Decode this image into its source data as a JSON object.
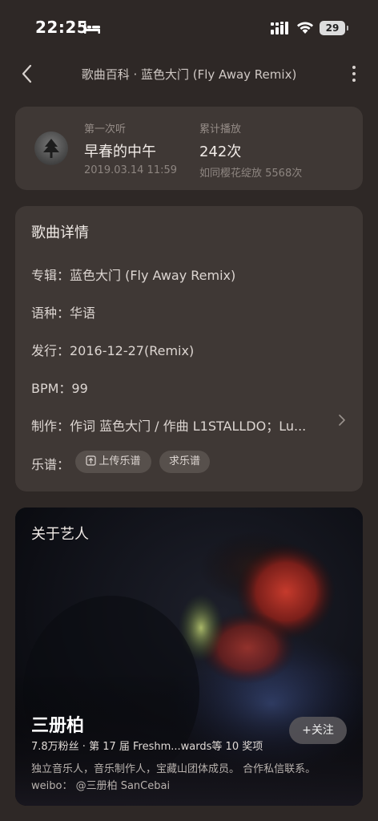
{
  "status": {
    "time": "22:25",
    "battery": "29"
  },
  "nav": {
    "title": "歌曲百科 · 蓝色大门 (Fly Away Remix)"
  },
  "first_listen": {
    "label": "第一次听",
    "value": "早春的中午",
    "date": "2019.03.14 11:59"
  },
  "play_count": {
    "label": "累计播放",
    "value": "242次",
    "note": "如同樱花绽放 5568次"
  },
  "details": {
    "heading": "歌曲详情",
    "album": "专辑：蓝色大门 (Fly Away Remix)",
    "language": "语种：华语",
    "release": "发行：2016-12-27(Remix)",
    "bpm": "BPM：99",
    "credits": "制作：作词 蓝色大门 / 作曲 L1STALLDO；Lu...",
    "sheet_label": "乐谱：",
    "upload_sheet": "上传乐谱",
    "request_sheet": "求乐谱"
  },
  "artist": {
    "heading": "关于艺人",
    "name": "三册柏",
    "meta": "7.8万粉丝 · 第 17 届 Freshm...wards等 10 奖项",
    "follow": "+关注",
    "bio": "独立音乐人，音乐制作人，宝藏山团体成员。 合作私信联系。 weibo： @三册柏 SanCebai"
  }
}
